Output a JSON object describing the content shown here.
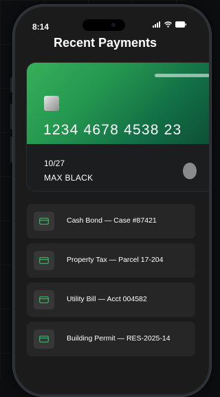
{
  "status_bar": {
    "time": "8:14"
  },
  "header": {
    "title": "Recent Payments"
  },
  "card": {
    "number": "1234 4678 4538 23",
    "expiry": "10/27",
    "holder": "MAX BLACK"
  },
  "payments": [
    {
      "label": "Cash Bond — Case #87421",
      "icon": "card-icon"
    },
    {
      "label": "Property Tax — Parcel 17-204",
      "icon": "card-icon"
    },
    {
      "label": "Utility Bill — Acct 004582",
      "icon": "card-icon"
    },
    {
      "label": "Building Permit — RES-2025-14",
      "icon": "card-icon"
    }
  ],
  "colors": {
    "card_gradient_start": "#36b05a",
    "card_gradient_end": "#0c4a33",
    "accent_icon": "#39b862",
    "row_background": "#262626"
  }
}
